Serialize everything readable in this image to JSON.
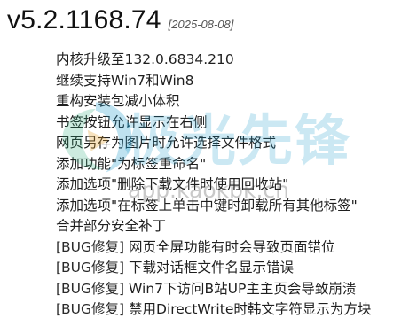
{
  "release": {
    "version": "v5.2.1168.74",
    "date": "[2025-08-08]"
  },
  "changes": [
    {
      "tag": "",
      "text": "内核升级至132.0.6834.210"
    },
    {
      "tag": "",
      "text": "继续支持Win7和Win8"
    },
    {
      "tag": "",
      "text": "重构安装包减小体积"
    },
    {
      "tag": "",
      "text": "书签按钮允许显示在右侧"
    },
    {
      "tag": "",
      "text": "网页另存为图片时允许选择文件格式"
    },
    {
      "tag": "",
      "text": "添加功能\"为标签重命名\""
    },
    {
      "tag": "",
      "text": "添加选项\"删除下载文件时使用回收站\""
    },
    {
      "tag": "",
      "text": "添加选项\"在标签上单击中键时卸载所有其他标签\""
    },
    {
      "tag": "",
      "text": "合并部分安全补丁"
    },
    {
      "tag": "[BUG修复]",
      "text": " 网页全屏功能有时会导致页面错位"
    },
    {
      "tag": "[BUG修复]",
      "text": " 下载对话框文件名显示错误"
    },
    {
      "tag": "[BUG修复]",
      "text": " Win7下访问B站UP主主页会导致崩溃"
    },
    {
      "tag": "[BUG修复]",
      "text": " 禁用DirectWrite时韩文字符显示为方块"
    }
  ],
  "watermark": {
    "name": "极光先锋",
    "url": "app.kaokbk.cn",
    "color": "#1496c8"
  }
}
